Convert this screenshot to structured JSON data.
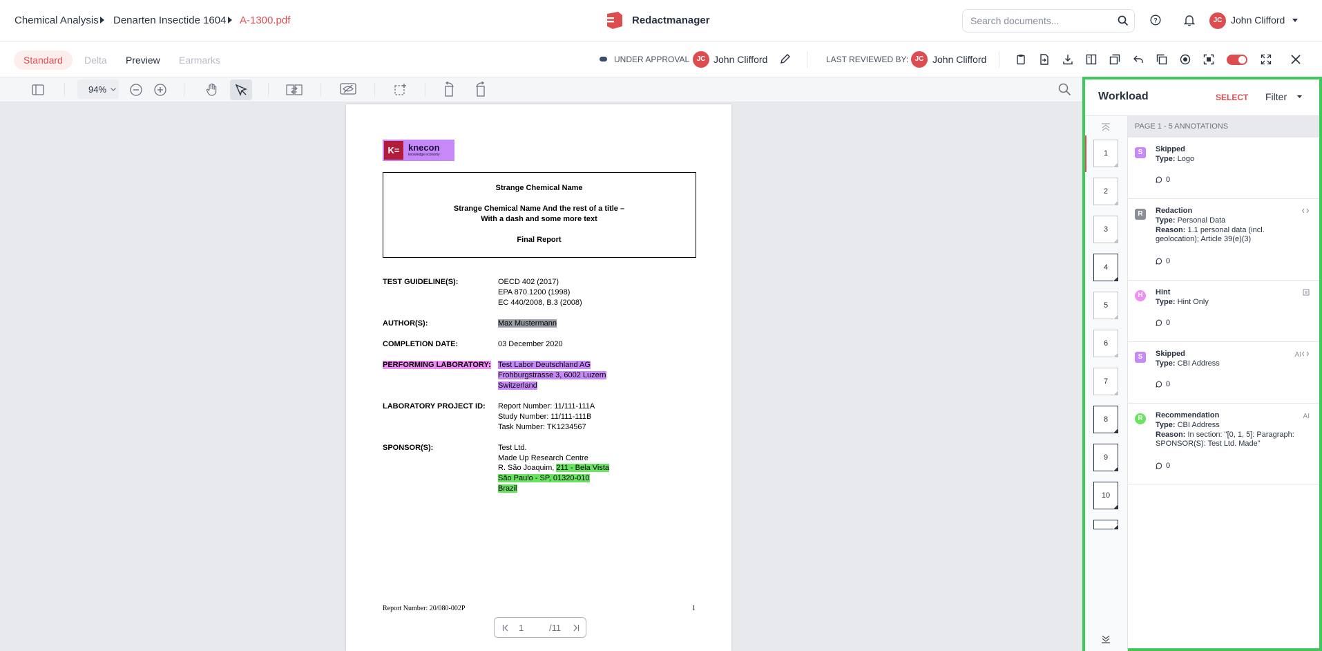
{
  "breadcrumb": {
    "item1": "Chemical Analysis",
    "item2": "Denarten Insectide 1604",
    "item3": "A-1300.pdf"
  },
  "brand": {
    "name": "Redactmanager"
  },
  "search": {
    "placeholder": "Search documents..."
  },
  "user": {
    "initials": "JC",
    "name": "John Clifford"
  },
  "view_tabs": {
    "standard": "Standard",
    "delta": "Delta",
    "preview": "Preview",
    "earmarks": "Earmarks"
  },
  "status": {
    "label": "UNDER APPROVAL",
    "assignee_initials": "JC",
    "assignee": "John Clifford",
    "last_reviewed_label": "LAST REVIEWED BY:",
    "reviewer_initials": "JC",
    "reviewer": "John Clifford"
  },
  "viewer": {
    "zoom": "94%",
    "current_page": "1",
    "total_pages": "/11"
  },
  "document": {
    "logo_text": "knecon",
    "logo_sub": "knowledge economy",
    "title1": "Strange Chemical Name",
    "title2": "Strange Chemical Name And the rest of a title –",
    "title3": "With a dash and some more text",
    "title4": "Final Report",
    "rows": [
      {
        "label": "TEST GUIDELINE(S):",
        "lines": [
          "OECD 402 (2017)",
          "EPA 870.1200 (1998)",
          "EC 440/2008, B.3 (2008)"
        ]
      },
      {
        "label": "AUTHOR(S):",
        "lines": [
          "Max Mustermann"
        ]
      },
      {
        "label": "COMPLETION DATE:",
        "lines": [
          "03 December 2020"
        ]
      },
      {
        "label": "PERFORMING LABORATORY:",
        "lines": [
          "Test Labor Deutschland AG",
          "Frohburgstrasse 3, 6002 Luzern",
          "Switzerland"
        ]
      },
      {
        "label": "LABORATORY PROJECT ID:",
        "lines": [
          "Report Number: 11/111-111A",
          "Study Number: 11/111-111B",
          "Task Number: TK1234567"
        ]
      },
      {
        "label": "SPONSOR(S):",
        "lines": [
          "Test Ltd.",
          "Made Up Research Centre",
          "R. São Joaquim, ",
          "211 - Bela Vista",
          "São Paulo - SP, 01320-010",
          "Brazil"
        ]
      }
    ],
    "footer_left": "Report Number: 20/080-002P",
    "footer_right": "1"
  },
  "workload": {
    "title": "Workload",
    "select": "SELECT",
    "filter": "Filter",
    "page_header": "PAGE 1 - 5 ANNOTATIONS",
    "thumbs": [
      "1",
      "2",
      "3",
      "4",
      "5",
      "6",
      "7",
      "8",
      "9",
      "10"
    ],
    "annotations": [
      {
        "badge": "S",
        "title": "Skipped",
        "type_label": "Type:",
        "type": "Logo",
        "count": "0",
        "color": "#c789f7"
      },
      {
        "badge": "R",
        "title": "Redaction",
        "type_label": "Type:",
        "type": "Personal Data",
        "reason_label": "Reason:",
        "reason": "1.1 personal data (incl. geolocation); Article 39(e)(3)",
        "count": "0",
        "color": "#8a8f98"
      },
      {
        "badge": "H",
        "title": "Hint",
        "type_label": "Type:",
        "type": "Hint Only",
        "count": "0",
        "color": "#f08ef5"
      },
      {
        "badge": "S",
        "title": "Skipped",
        "type_label": "Type:",
        "type": "CBI Address",
        "tag": "AI",
        "count": "0",
        "color": "#c789f7"
      },
      {
        "badge": "R",
        "title": "Recommendation",
        "type_label": "Type:",
        "type": "CBI Address",
        "reason_label": "Reason:",
        "reason": "In section: \"[0, 1, 5]: Paragraph: SPONSOR(S): Test Ltd. Made\"",
        "tag": "AI",
        "count": "0",
        "color": "#69e360"
      }
    ]
  }
}
